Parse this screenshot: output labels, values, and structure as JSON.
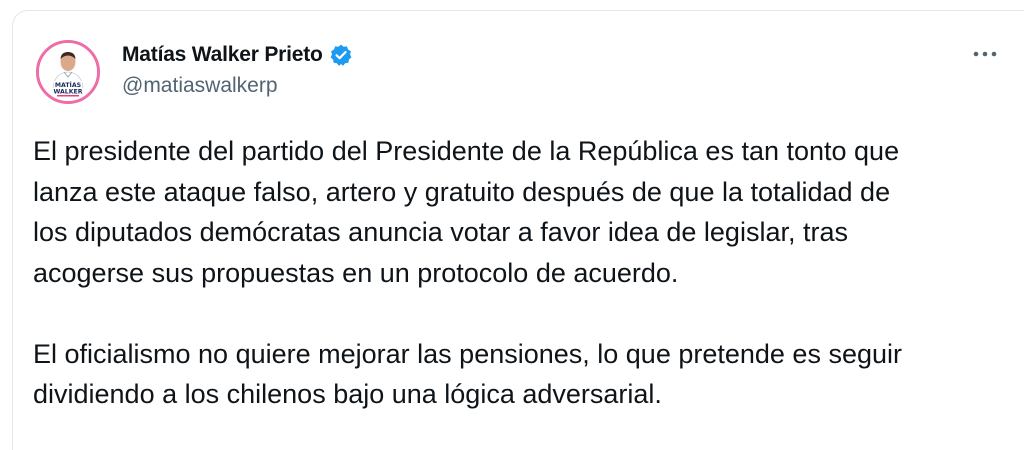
{
  "author": {
    "name": "Matías Walker Prieto",
    "handle": "@matiaswalkerp",
    "avatar_badge_text": "MATÍAS WALKER",
    "avatar_border_color": "#f06ca6",
    "verified": true,
    "verified_color": "#1d9bf0"
  },
  "menu": {
    "icon": "more-horizontal-icon"
  },
  "tweet": {
    "paragraph1_lines": [
      "El presidente del partido del Presidente de la República es tan tonto que",
      "lanza este ataque falso, artero y gratuito después de que la totalidad de",
      "los diputados demócratas anuncia votar a favor idea de legislar, tras",
      "acogerse sus propuestas en un protocolo de acuerdo."
    ],
    "paragraph2_lines": [
      "El oficialismo no quiere mejorar las pensiones, lo que pretende es seguir",
      "dividiendo a los chilenos bajo una lógica adversarial."
    ]
  }
}
